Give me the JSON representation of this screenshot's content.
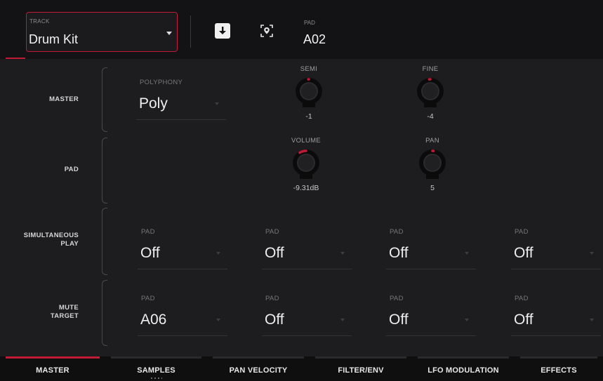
{
  "header": {
    "track_label": "TRACK",
    "track_value": "Drum Kit",
    "pad_label": "PAD",
    "pad_value": "A02",
    "icons": [
      "download-icon",
      "locate-icon"
    ]
  },
  "rows": {
    "master": "MASTER",
    "pad": "PAD",
    "simultaneous_play_line1": "SIMULTANEOUS",
    "simultaneous_play_line2": "PLAY",
    "mute_target_line1": "MUTE",
    "mute_target_line2": "TARGET"
  },
  "master": {
    "polyphony_label": "POLYPHONY",
    "polyphony_value": "Poly",
    "semi": {
      "label": "SEMI",
      "value": "-1",
      "level": 0.49
    },
    "fine": {
      "label": "FINE",
      "value": "-4",
      "level": 0.48
    }
  },
  "pad": {
    "volume": {
      "label": "VOLUME",
      "value": "-9.31dB",
      "level": 0.38
    },
    "pan": {
      "label": "PAN",
      "value": "5",
      "level": 0.52
    }
  },
  "simultaneous_play": [
    {
      "label": "PAD",
      "value": "Off"
    },
    {
      "label": "PAD",
      "value": "Off"
    },
    {
      "label": "PAD",
      "value": "Off"
    },
    {
      "label": "PAD",
      "value": "Off"
    }
  ],
  "mute_target": [
    {
      "label": "PAD",
      "value": "A06"
    },
    {
      "label": "PAD",
      "value": "Off"
    },
    {
      "label": "PAD",
      "value": "Off"
    },
    {
      "label": "PAD",
      "value": "Off"
    }
  ],
  "tabs": [
    {
      "label": "MASTER",
      "active": true
    },
    {
      "label": "SAMPLES",
      "active": false
    },
    {
      "label": "PAN VELOCITY",
      "active": false
    },
    {
      "label": "FILTER/ENV",
      "active": false
    },
    {
      "label": "LFO MODULATION",
      "active": false
    },
    {
      "label": "EFFECTS",
      "active": false
    }
  ],
  "colors": {
    "accent": "#c01a35",
    "background": "#1d1d1f",
    "header": "#131315"
  }
}
